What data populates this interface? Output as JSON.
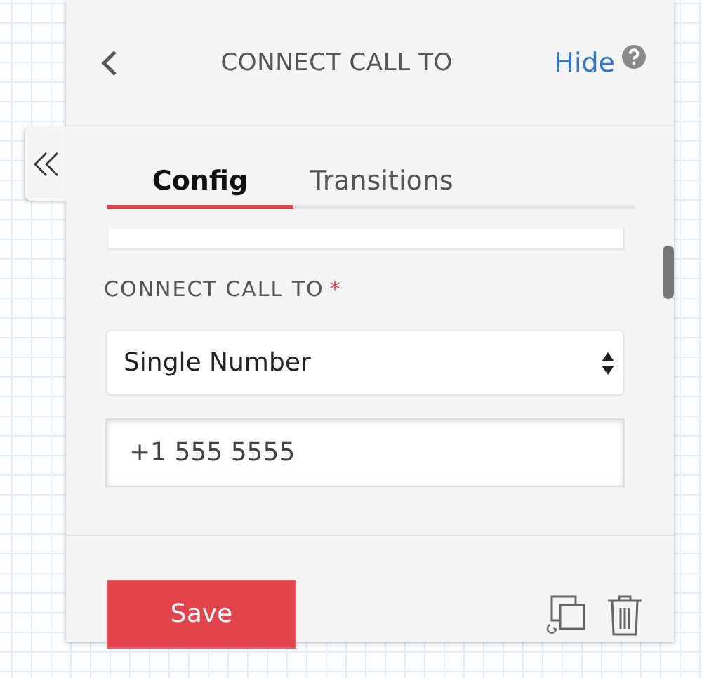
{
  "header": {
    "title": "CONNECT CALL TO",
    "hide_link": "Hide"
  },
  "tabs": [
    {
      "label": "Config",
      "selected": true
    },
    {
      "label": "Transitions",
      "selected": false
    }
  ],
  "form": {
    "label": "CONNECT CALL TO",
    "required_mark": "*",
    "select_value": "Single Number",
    "phone_value": "+1 555 5555"
  },
  "footer": {
    "save_button": "Save"
  }
}
